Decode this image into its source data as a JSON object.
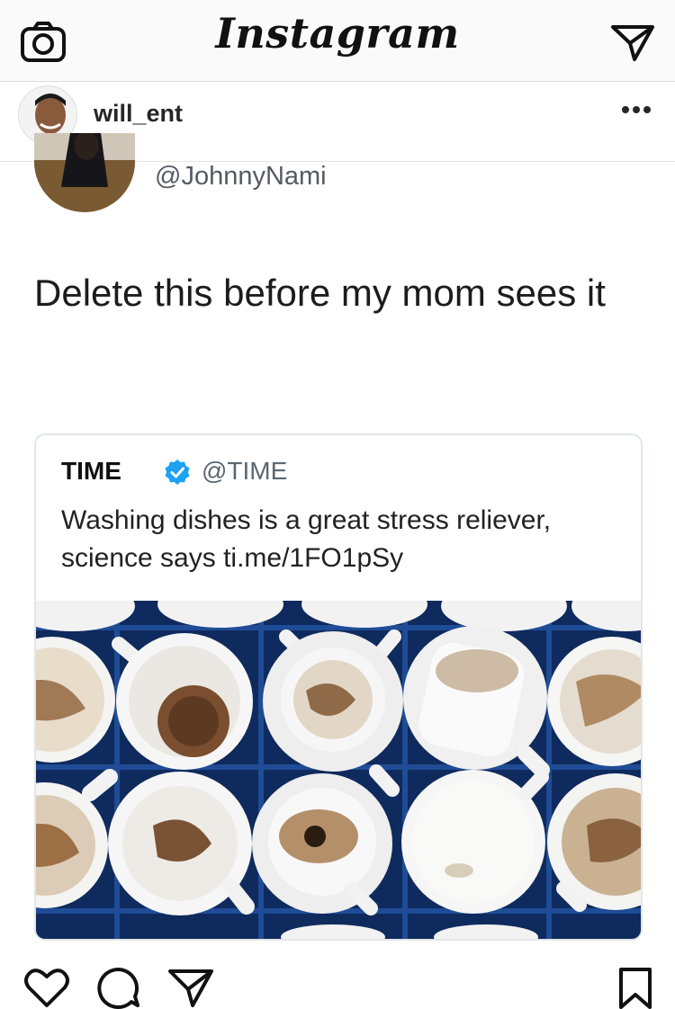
{
  "app": {
    "title": "Instagram"
  },
  "post": {
    "username": "will_ent"
  },
  "tweet": {
    "handle": "@JohnnyNami",
    "text": "Delete this before my mom sees it",
    "quoted": {
      "name": "TIME",
      "handle": "@TIME",
      "text": "Washing dishes is a great stress reliever, science says ti.me/1FO1pSy"
    }
  },
  "colors": {
    "verified": "#1da1f2",
    "crate": "#153a7a"
  },
  "icons": [
    "camera-icon",
    "direct-message-icon",
    "more-options-icon",
    "verified-badge-icon",
    "heart-icon",
    "comment-icon",
    "share-icon",
    "bookmark-icon"
  ]
}
